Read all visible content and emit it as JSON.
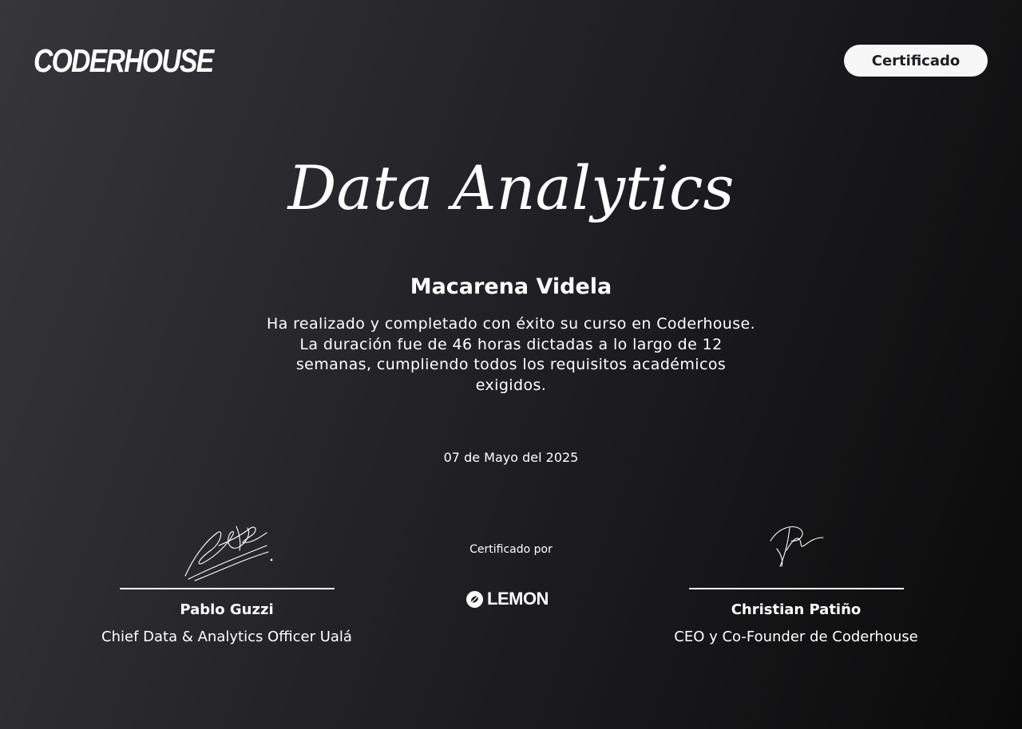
{
  "header": {
    "brand_logo_text": "CODERHOUSE",
    "badge_label": "Certificado"
  },
  "certificate": {
    "course_title": "Data Analytics",
    "student_name": "Macarena Videla",
    "description": "Ha realizado y completado con éxito su curso en Coderhouse. La duración fue de 46 horas dictadas a lo largo de 12 semanas, cumpliendo todos los requisitos académicos exigidos.",
    "date": "07 de Mayo del 2025"
  },
  "signatories": [
    {
      "name": "Pablo Guzzi",
      "role": "Chief Data & Analytics Officer Ualá"
    },
    {
      "name": "Christian Patiño",
      "role": "CEO y Co-Founder de Coderhouse"
    }
  ],
  "partner": {
    "certified_by_label": "Certificado por",
    "logo_text": "LEMON"
  },
  "colors": {
    "background_start": "#36363b",
    "background_end": "#0a0a0a",
    "text": "#ffffff",
    "badge_background": "#f7f7f7",
    "badge_text": "#1e1e22"
  },
  "icons": {
    "left_signature": "handwritten-signature",
    "right_signature": "handwritten-signature",
    "partner_mark": "lemon-logo-icon"
  }
}
